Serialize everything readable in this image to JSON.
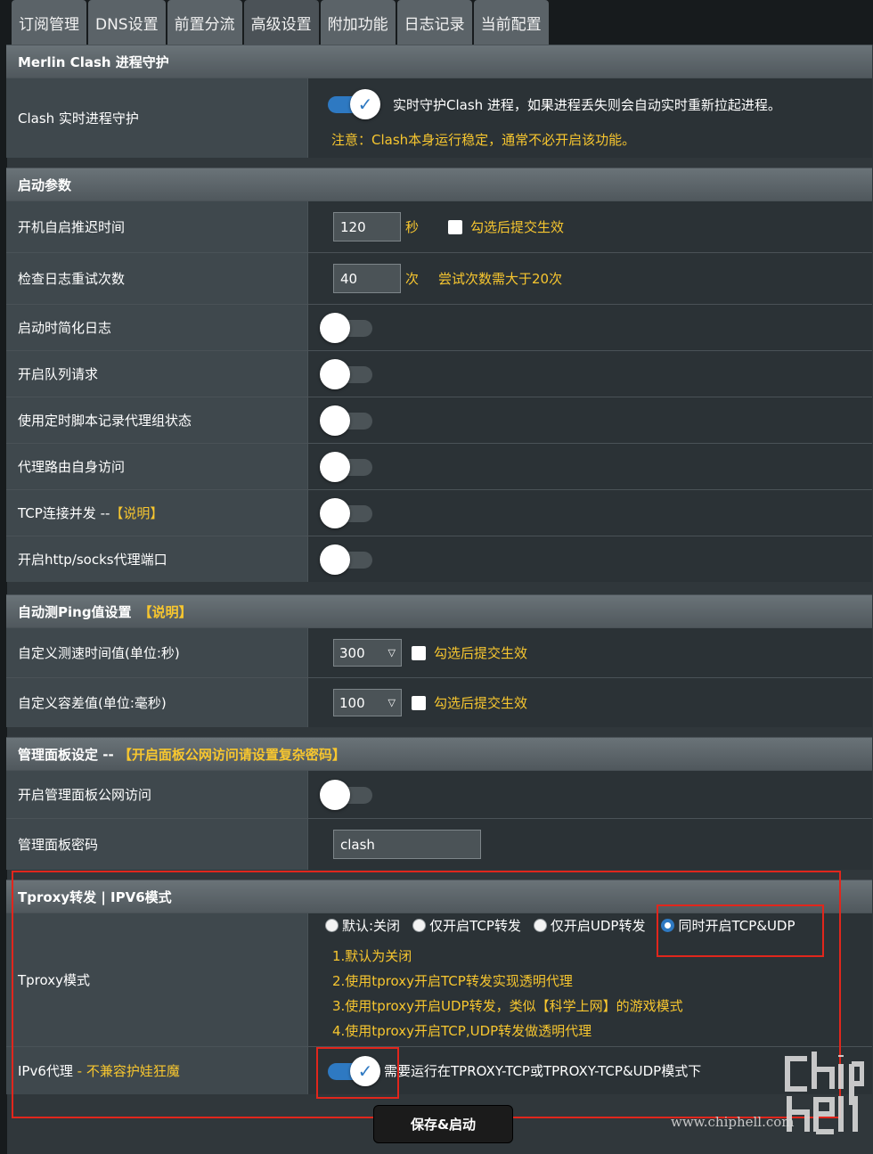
{
  "tabs": [
    "订阅管理",
    "DNS设置",
    "前置分流",
    "高级设置",
    "附加功能",
    "日志记录",
    "当前配置"
  ],
  "active_tab": "高级设置",
  "colors": {
    "accent": "#2e79c2",
    "highlight": "#f7c62f",
    "annotation_red": "#e1261c"
  },
  "daemon": {
    "title": "Merlin Clash  进程守护",
    "label": "Clash 实时进程守护",
    "toggle": "on",
    "desc": "实时守护Clash 进程，如果进程丢失则会自动实时重新拉起进程。",
    "note": "注意：Clash本身运行稳定，通常不必开启该功能。"
  },
  "startup": {
    "title": "启动参数",
    "delay_label": "开机自启推迟时间",
    "delay_value": "120",
    "delay_unit": "秒",
    "delay_checkbox_label": "勾选后提交生效",
    "retry_label": "检查日志重试次数",
    "retry_value": "40",
    "retry_unit": "次",
    "retry_hint": "尝试次数需大于20次",
    "simple_log_label": "启动时简化日志",
    "queue_label": "开启队列请求",
    "cron_label": "使用定时脚本记录代理组状态",
    "self_access_label": "代理路由自身访问",
    "tcp_concurrent_label": "TCP连接并发 -- ",
    "tcp_concurrent_link": "【说明】",
    "http_socks_label": "开启http/socks代理端口"
  },
  "ping": {
    "title": "自动测Ping值设置",
    "title_link": "【说明】",
    "interval_label": "自定义测速时间值(单位:秒)",
    "interval_value": "300",
    "interval_checkbox_label": "勾选后提交生效",
    "tolerance_label": "自定义容差值(单位:毫秒)",
    "tolerance_value": "100",
    "tolerance_checkbox_label": "勾选后提交生效"
  },
  "dashboard": {
    "title": "管理面板设定 -- ",
    "title_warning": "【开启面板公网访问请设置复杂密码】",
    "public_label": "开启管理面板公网访问",
    "password_label": "管理面板密码",
    "password_value": "clash"
  },
  "tproxy": {
    "title": "Tproxy转发 | IPV6模式",
    "mode_label": "Tproxy模式",
    "options": [
      "默认:关闭",
      "仅开启TCP转发",
      "仅开启UDP转发",
      "同时开启TCP&UDP"
    ],
    "selected_option": "同时开启TCP&UDP",
    "notes": [
      "1.默认为关闭",
      "2.使用tproxy开启TCP转发实现透明代理",
      "3.使用tproxy开启UDP转发，类似【科学上网】的游戏模式",
      "4.使用tproxy开启TCP,UDP转发做透明代理"
    ],
    "ipv6_label": "IPv6代理",
    "ipv6_warning": " - 不兼容护娃狂魔",
    "ipv6_toggle": "on",
    "ipv6_desc": "需要运行在TPROXY-TCP或TPROXY-TCP&UDP模式下"
  },
  "save_button": "保存&启动",
  "watermark": "www.chiphell.com",
  "logo_text": "chip hell"
}
